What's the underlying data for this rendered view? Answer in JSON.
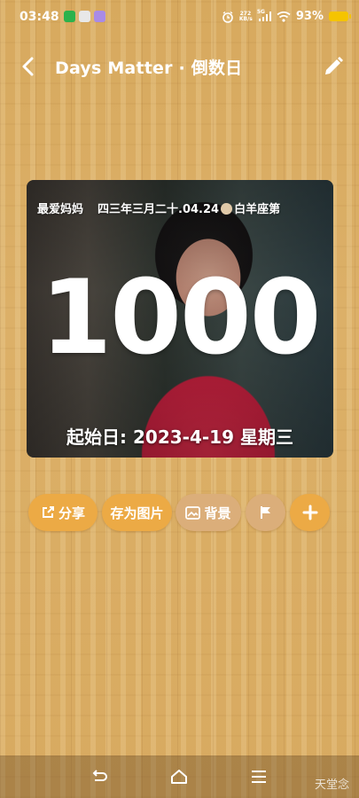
{
  "status_bar": {
    "time": "03:48",
    "net_speed_value": "272",
    "net_speed_unit": "KB/s",
    "network": "5G",
    "battery": "93%",
    "notification_icons": [
      "wechat-icon",
      "browser-icon",
      "app-icon"
    ]
  },
  "header": {
    "title": "Days Matter · 倒数日",
    "back_icon": "chevron-left-icon",
    "edit_icon": "pencil-icon"
  },
  "card": {
    "name": "最爱妈妈",
    "lunar": "四三年三月二十.04.24",
    "zodiac": "白羊座第",
    "days": "1000",
    "start_date": "起始日: 2023-4-19 星期三"
  },
  "actions": {
    "share": "分享",
    "save_image": "存为图片",
    "background": "背景",
    "flag_icon": "flag-icon",
    "add_icon": "plus-icon"
  },
  "nav_bar": {
    "watermark": "天堂念"
  },
  "colors": {
    "accent": "#ecaa45",
    "battery": "#f5c400"
  }
}
